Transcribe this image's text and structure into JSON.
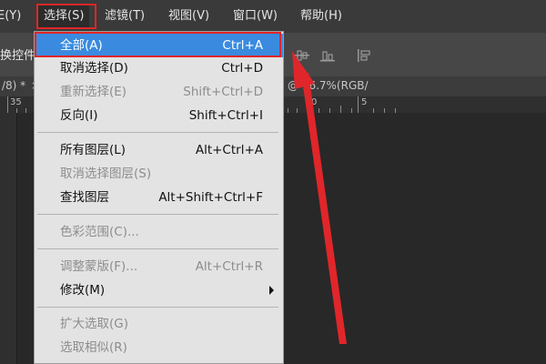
{
  "menubar": {
    "items": [
      {
        "label": "E(Y)"
      },
      {
        "label": "选择(S)"
      },
      {
        "label": "滤镜(T)"
      },
      {
        "label": "视图(V)"
      },
      {
        "label": "窗口(W)"
      },
      {
        "label": "帮助(H)"
      }
    ]
  },
  "options_bar": {
    "label": "换控件"
  },
  "doc_tab": {
    "left_text": "/8) *",
    "close_glyph": "×",
    "right_text": "@ 16.7%(RGB/"
  },
  "ruler": {
    "labels": [
      "35",
      "0",
      "5"
    ]
  },
  "dropdown": {
    "items": [
      {
        "label": "全部(A)",
        "shortcut": "Ctrl+A",
        "state": "selected"
      },
      {
        "label": "取消选择(D)",
        "shortcut": "Ctrl+D",
        "state": "enabled"
      },
      {
        "label": "重新选择(E)",
        "shortcut": "Shift+Ctrl+D",
        "state": "disabled"
      },
      {
        "label": "反向(I)",
        "shortcut": "Shift+Ctrl+I",
        "state": "enabled"
      },
      {
        "label": "所有图层(L)",
        "shortcut": "Alt+Ctrl+A",
        "state": "enabled"
      },
      {
        "label": "取消选择图层(S)",
        "shortcut": "",
        "state": "disabled"
      },
      {
        "label": "查找图层",
        "shortcut": "Alt+Shift+Ctrl+F",
        "state": "enabled"
      },
      {
        "label": "色彩范围(C)...",
        "shortcut": "",
        "state": "disabled"
      },
      {
        "label": "调整蒙版(F)...",
        "shortcut": "Alt+Ctrl+R",
        "state": "disabled"
      },
      {
        "label": "修改(M)",
        "shortcut": "",
        "state": "enabled"
      },
      {
        "label": "扩大选取(G)",
        "shortcut": "",
        "state": "disabled"
      },
      {
        "label": "选取相似(R)",
        "shortcut": "",
        "state": "disabled"
      }
    ]
  },
  "colors": {
    "annotation_red": "#e02626",
    "menu_selection_blue": "#3a8be0",
    "menubar_bg": "#3a3a3a",
    "dropdown_bg": "#e3e3e3"
  },
  "icons": [
    "align-icon",
    "submenu-arrow-icon",
    "annotation-arrow"
  ]
}
